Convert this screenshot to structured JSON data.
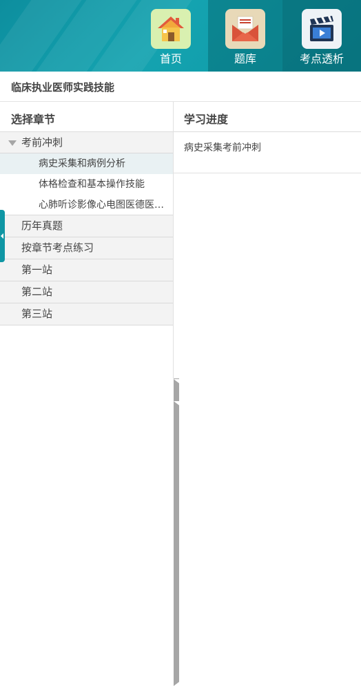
{
  "nav": [
    {
      "label": "首页",
      "icon": "home-icon"
    },
    {
      "label": "题库",
      "icon": "envelope-icon"
    },
    {
      "label": "考点透析",
      "icon": "video-clapper-icon"
    }
  ],
  "page_title": "临床执业医师实践技能",
  "left_panel": {
    "heading": "选择章节",
    "groups": [
      {
        "label": "考前冲刺",
        "expanded": true,
        "items": [
          {
            "label": "病史采集和病例分析",
            "selected": true
          },
          {
            "label": "体格检查和基本操作技能"
          },
          {
            "label": "心肺听诊影像心电图医德医…"
          }
        ]
      },
      {
        "label": "历年真题"
      },
      {
        "label": "按章节考点练习"
      },
      {
        "label": "第一站"
      },
      {
        "label": "第二站"
      },
      {
        "label": "第三站"
      }
    ]
  },
  "right_panel": {
    "heading": "学习进度",
    "current": "病史采集考前冲刺"
  },
  "colors": {
    "header_teal": "#14a3b0",
    "selected_row": "#e9f1f3",
    "group_bg": "#f3f3f3"
  }
}
